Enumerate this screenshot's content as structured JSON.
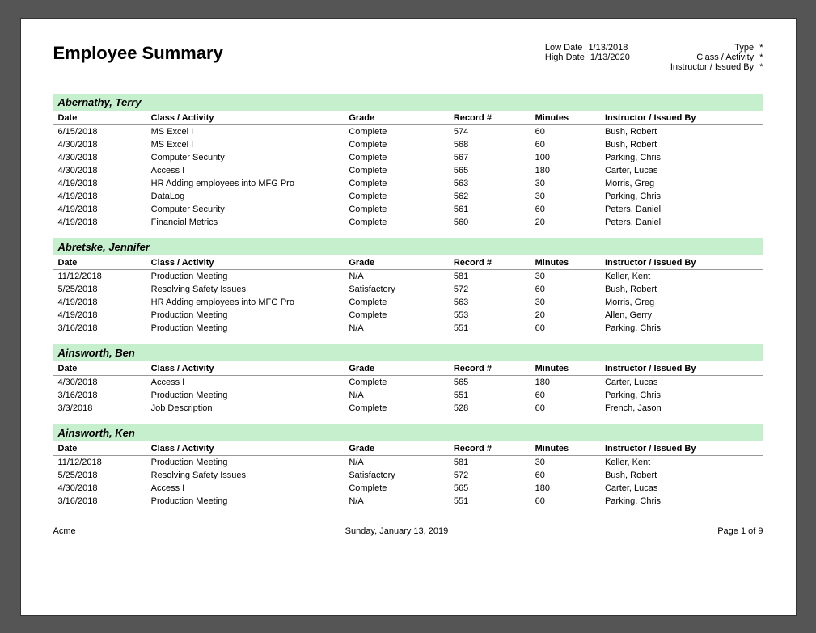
{
  "report": {
    "title": "Employee Summary",
    "low_date_label": "Low Date",
    "low_date_value": "1/13/2018",
    "high_date_label": "High Date",
    "high_date_value": "1/13/2020",
    "type_label": "Type",
    "type_value": "*",
    "class_activity_label": "Class / Activity",
    "class_activity_value": "*",
    "instructor_label": "Instructor / Issued By",
    "instructor_value": "*"
  },
  "columns": {
    "date": "Date",
    "class": "Class / Activity",
    "grade": "Grade",
    "record": "Record #",
    "minutes": "Minutes",
    "instructor": "Instructor / Issued By"
  },
  "employees": [
    {
      "name": "Abernathy, Terry",
      "rows": [
        {
          "date": "6/15/2018",
          "class": "MS Excel I",
          "grade": "Complete",
          "record": "574",
          "minutes": "60",
          "instructor": "Bush, Robert"
        },
        {
          "date": "4/30/2018",
          "class": "MS Excel I",
          "grade": "Complete",
          "record": "568",
          "minutes": "60",
          "instructor": "Bush, Robert"
        },
        {
          "date": "4/30/2018",
          "class": "Computer Security",
          "grade": "Complete",
          "record": "567",
          "minutes": "100",
          "instructor": "Parking, Chris"
        },
        {
          "date": "4/30/2018",
          "class": "Access I",
          "grade": "Complete",
          "record": "565",
          "minutes": "180",
          "instructor": "Carter, Lucas"
        },
        {
          "date": "4/19/2018",
          "class": "HR Adding employees into MFG Pro",
          "grade": "Complete",
          "record": "563",
          "minutes": "30",
          "instructor": "Morris, Greg"
        },
        {
          "date": "4/19/2018",
          "class": "DataLog",
          "grade": "Complete",
          "record": "562",
          "minutes": "30",
          "instructor": "Parking, Chris"
        },
        {
          "date": "4/19/2018",
          "class": "Computer Security",
          "grade": "Complete",
          "record": "561",
          "minutes": "60",
          "instructor": "Peters, Daniel"
        },
        {
          "date": "4/19/2018",
          "class": "Financial Metrics",
          "grade": "Complete",
          "record": "560",
          "minutes": "20",
          "instructor": "Peters, Daniel"
        }
      ]
    },
    {
      "name": "Abretske, Jennifer",
      "rows": [
        {
          "date": "11/12/2018",
          "class": "Production Meeting",
          "grade": "N/A",
          "record": "581",
          "minutes": "30",
          "instructor": "Keller, Kent"
        },
        {
          "date": "5/25/2018",
          "class": "Resolving Safety Issues",
          "grade": "Satisfactory",
          "record": "572",
          "minutes": "60",
          "instructor": "Bush, Robert"
        },
        {
          "date": "4/19/2018",
          "class": "HR Adding employees into MFG Pro",
          "grade": "Complete",
          "record": "563",
          "minutes": "30",
          "instructor": "Morris, Greg"
        },
        {
          "date": "4/19/2018",
          "class": "Production Meeting",
          "grade": "Complete",
          "record": "553",
          "minutes": "20",
          "instructor": "Allen, Gerry"
        },
        {
          "date": "3/16/2018",
          "class": "Production Meeting",
          "grade": "N/A",
          "record": "551",
          "minutes": "60",
          "instructor": "Parking, Chris"
        }
      ]
    },
    {
      "name": "Ainsworth, Ben",
      "rows": [
        {
          "date": "4/30/2018",
          "class": "Access I",
          "grade": "Complete",
          "record": "565",
          "minutes": "180",
          "instructor": "Carter, Lucas"
        },
        {
          "date": "3/16/2018",
          "class": "Production Meeting",
          "grade": "N/A",
          "record": "551",
          "minutes": "60",
          "instructor": "Parking, Chris"
        },
        {
          "date": "3/3/2018",
          "class": "Job Description",
          "grade": "Complete",
          "record": "528",
          "minutes": "60",
          "instructor": "French, Jason"
        }
      ]
    },
    {
      "name": "Ainsworth, Ken",
      "rows": [
        {
          "date": "11/12/2018",
          "class": "Production Meeting",
          "grade": "N/A",
          "record": "581",
          "minutes": "30",
          "instructor": "Keller, Kent"
        },
        {
          "date": "5/25/2018",
          "class": "Resolving Safety Issues",
          "grade": "Satisfactory",
          "record": "572",
          "minutes": "60",
          "instructor": "Bush, Robert"
        },
        {
          "date": "4/30/2018",
          "class": "Access I",
          "grade": "Complete",
          "record": "565",
          "minutes": "180",
          "instructor": "Carter, Lucas"
        },
        {
          "date": "3/16/2018",
          "class": "Production Meeting",
          "grade": "N/A",
          "record": "551",
          "minutes": "60",
          "instructor": "Parking, Chris"
        }
      ]
    }
  ],
  "footer": {
    "company": "Acme",
    "date": "Sunday, January 13, 2019",
    "page": "Page 1 of 9"
  }
}
